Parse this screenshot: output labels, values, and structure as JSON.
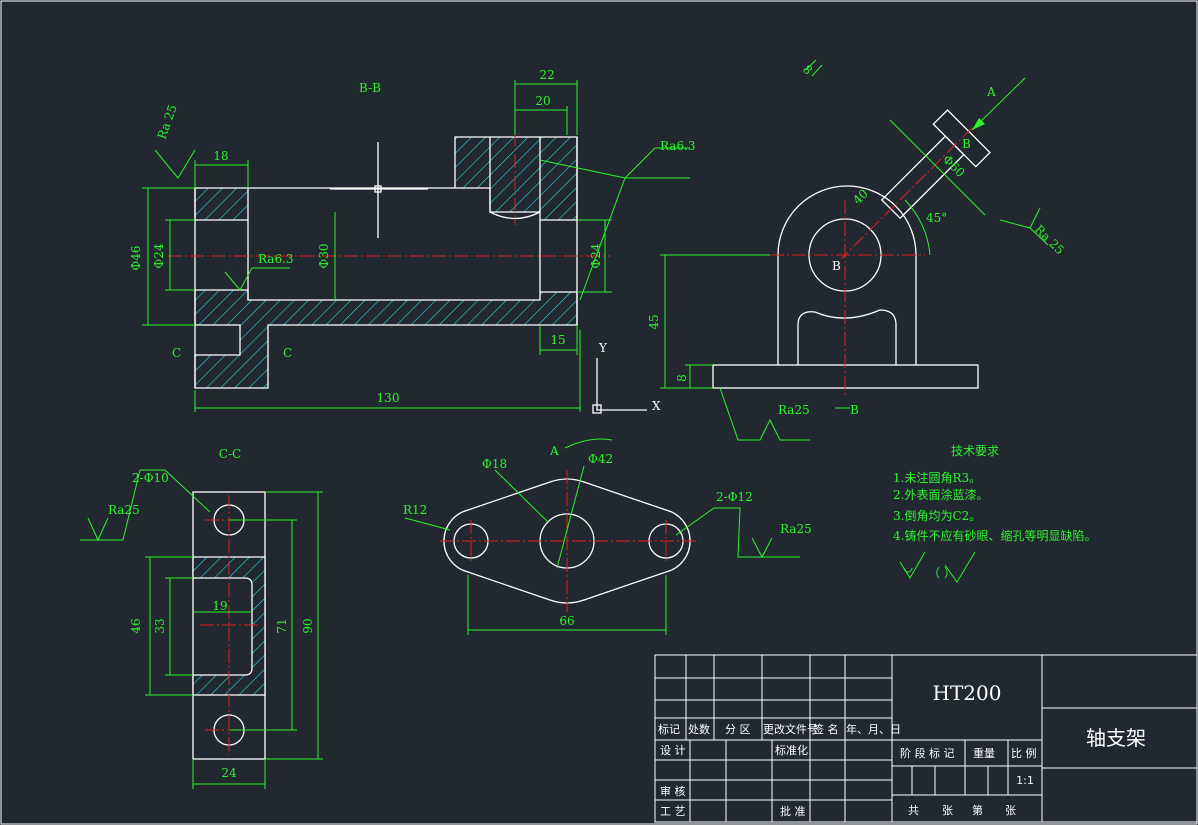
{
  "views": {
    "section_bb": "B-B",
    "section_cc": "C-C",
    "cut_label_c_left": "C",
    "cut_label_c_right": "C",
    "view_a": "A",
    "view_a_arrow": "A",
    "label_b": "B",
    "label_b_bottom": "B",
    "label_b_top": "B"
  },
  "dims": {
    "d22": "22",
    "d20": "20",
    "d18": "18",
    "d46": "Φ46",
    "d24a": "Φ24",
    "d30": "Φ30",
    "d24b": "Φ24",
    "d15": "15",
    "d130": "130",
    "d8_top": "8",
    "d60": "Φ60",
    "d40": "40",
    "d45deg": "45°",
    "d45": "45",
    "d8_base": "8",
    "d2phi10": "2-Φ10",
    "d46_cc": "46",
    "d33": "33",
    "d19": "19",
    "d71": "71",
    "d90": "90",
    "d24_cc": "24",
    "d18_top": "Φ18",
    "d42": "Φ42",
    "r12": "R12",
    "d2phi12": "2-Φ12",
    "d66": "66"
  },
  "roughness": {
    "ra25_left": "Ra 25",
    "ra63_right": "Ra6.3",
    "ra63_inner": "Ra6.3",
    "ra25_side": "Ra 25",
    "ra25_base": "Ra25",
    "ra25_cc": "Ra25",
    "ra25_top": "Ra25"
  },
  "ucs": {
    "y": "Y",
    "x": "X"
  },
  "tech_req": {
    "title": "技术要求",
    "items": [
      "1.未注圆角R3。",
      "2.外表面涂蓝漆。",
      "3.倒角均为C2。",
      "4.铸件不应有砂眼、缩孔等明显缺陷。"
    ],
    "symbol_note": "（    ）"
  },
  "title_block": {
    "material": "HT200",
    "part_name": "轴支架",
    "h_biaoji": "标记",
    "h_chushu": "处数",
    "h_fenqu": "分 区",
    "h_gengai": "更改文件号",
    "h_qianming": "签 名",
    "h_date": "年、月、日",
    "sheji": "设 计",
    "biaozhunhua": "标准化",
    "shenhe": "审 核",
    "gongyi": "工 艺",
    "pizhun": "批 准",
    "jieduan": "阶 段 标 记",
    "zhongliang": "重量",
    "bili": "比 例",
    "scale": "1:1",
    "gong": "共",
    "zhang1": "张",
    "di": "第",
    "zhang2": "张"
  }
}
